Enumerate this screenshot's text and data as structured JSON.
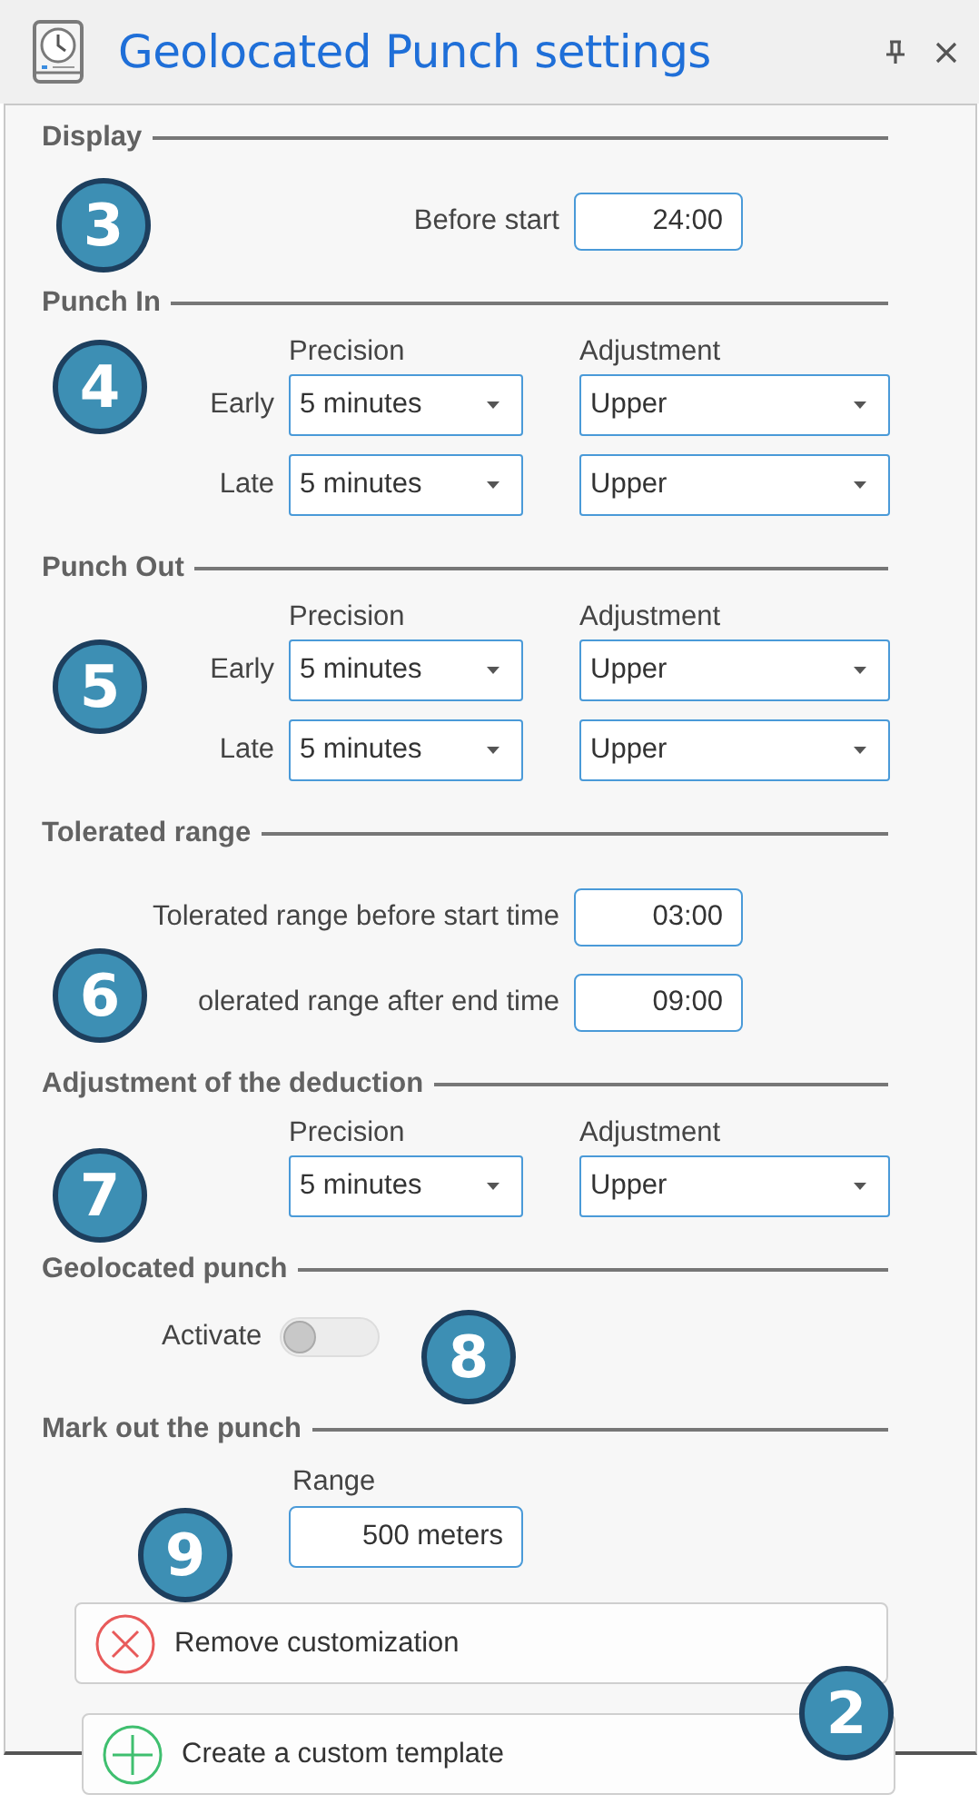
{
  "window": {
    "title": "Geolocated Punch settings"
  },
  "sections": [
    {
      "title": "Display",
      "kind": "fields",
      "rows": [
        {
          "label": "Before start",
          "value": "24:00"
        }
      ]
    },
    {
      "title": "Punch In",
      "kind": "dropdowns",
      "columns": [
        "Precision",
        "Adjustment"
      ],
      "rows": [
        {
          "label": "Early",
          "values": [
            "5 minutes",
            "Upper"
          ]
        },
        {
          "label": "Late",
          "values": [
            "5 minutes",
            "Upper"
          ]
        }
      ]
    },
    {
      "title": "Punch Out",
      "kind": "dropdowns",
      "columns": [
        "Precision",
        "Adjustment"
      ],
      "rows": [
        {
          "label": "Early",
          "values": [
            "5 minutes",
            "Upper"
          ]
        },
        {
          "label": "Late",
          "values": [
            "5 minutes",
            "Upper"
          ]
        }
      ]
    },
    {
      "title": "Tolerated range",
      "kind": "fields",
      "rows": [
        {
          "label": "Tolerated range before start time",
          "value": "03:00"
        },
        {
          "label": "olerated range after end time",
          "value": "09:00"
        }
      ]
    },
    {
      "title": "Adjustment of the deduction",
      "kind": "dropdowns",
      "columns": [
        "Precision",
        "Adjustment"
      ],
      "rows": [
        {
          "values": [
            "5 minutes",
            "Upper"
          ]
        }
      ]
    },
    {
      "title": "Geolocated punch",
      "kind": "toggle",
      "label": "Activate",
      "on": false
    },
    {
      "title": "Mark out the punch",
      "kind": "range",
      "label": "Range",
      "value": "500 meters"
    }
  ],
  "buttons": [
    {
      "label": "Remove customization",
      "kind": "remove"
    },
    {
      "label": "Create a custom template",
      "kind": "create"
    }
  ],
  "callouts": [
    {
      "label": "3"
    },
    {
      "label": "4"
    },
    {
      "label": "5"
    },
    {
      "label": "6"
    },
    {
      "label": "7"
    },
    {
      "label": "8"
    },
    {
      "label": "9"
    },
    {
      "label": "2"
    }
  ]
}
